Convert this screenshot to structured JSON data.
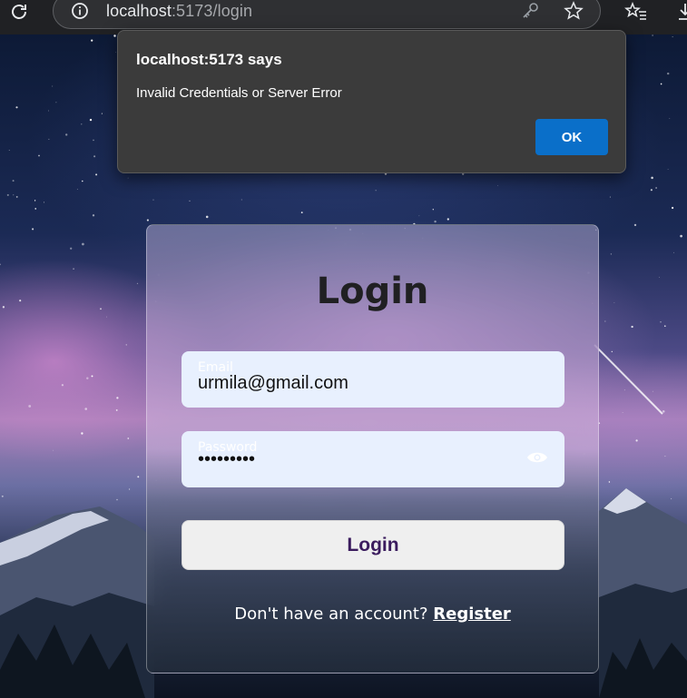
{
  "browser": {
    "url_host": "localhost",
    "url_path": ":5173/login"
  },
  "dialog": {
    "title": "localhost:5173 says",
    "message": "Invalid Credentials or Server Error",
    "ok_label": "OK"
  },
  "login": {
    "title": "Login",
    "email_label": "Email",
    "email_value": "urmila@gmail.com",
    "password_label": "Password",
    "password_mask": "•••••••••",
    "submit_label": "Login",
    "register_prompt": "Don't have an account?",
    "register_link": "Register"
  },
  "colors": {
    "dialog_bg": "#3b3b3b",
    "ok_button": "#0a6fc9",
    "input_bg": "#e8f0fe",
    "login_text": "#3b1c5e"
  }
}
